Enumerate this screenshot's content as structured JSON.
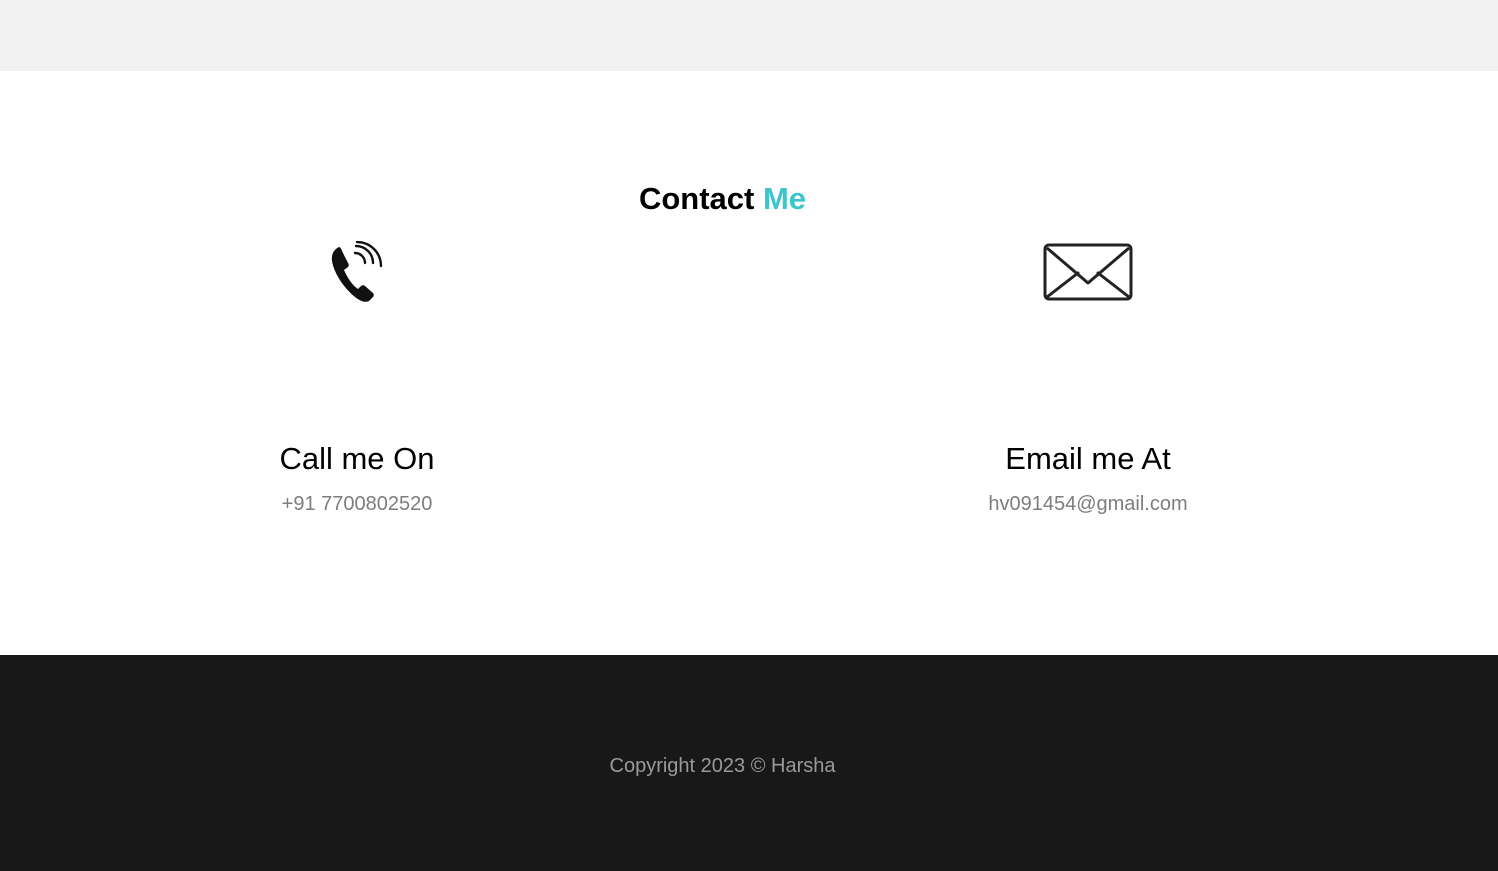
{
  "top_band": {},
  "contact": {
    "title_main": "Contact",
    "title_accent": "Me",
    "phone": {
      "icon": "phone-icon",
      "heading": "Call me On",
      "value": "+91 7700802520"
    },
    "email": {
      "icon": "envelope-icon",
      "heading": "Email me At",
      "value": "hv091454@gmail.com"
    }
  },
  "footer": {
    "copyright": "Copyright 2023 © Harsha"
  },
  "colors": {
    "accent": "#3cc6cc",
    "top_band": "#f2f2f2",
    "footer_bg": "#181818",
    "muted_text": "#7d7d7d"
  }
}
